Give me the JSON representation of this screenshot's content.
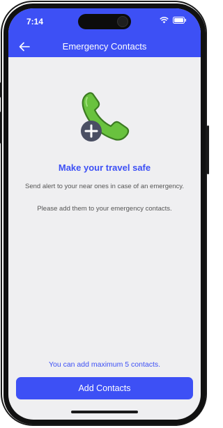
{
  "status_bar": {
    "time": "7:14"
  },
  "header": {
    "title": "Emergency Contacts",
    "back_icon": "arrow-left-icon"
  },
  "hero": {
    "icon": "phone-add-icon",
    "phone_color": "#69c23e",
    "plus_badge_color": "#4a4f63"
  },
  "content": {
    "headline": "Make your travel safe",
    "description_1": "Send alert to your near ones in case of an emergency.",
    "description_2": "Please add them to your emergency contacts."
  },
  "footer": {
    "max_note": "You can add maximum 5 contacts.",
    "add_button_label": "Add Contacts"
  },
  "colors": {
    "accent": "#3d50f5",
    "background": "#efeff1"
  }
}
